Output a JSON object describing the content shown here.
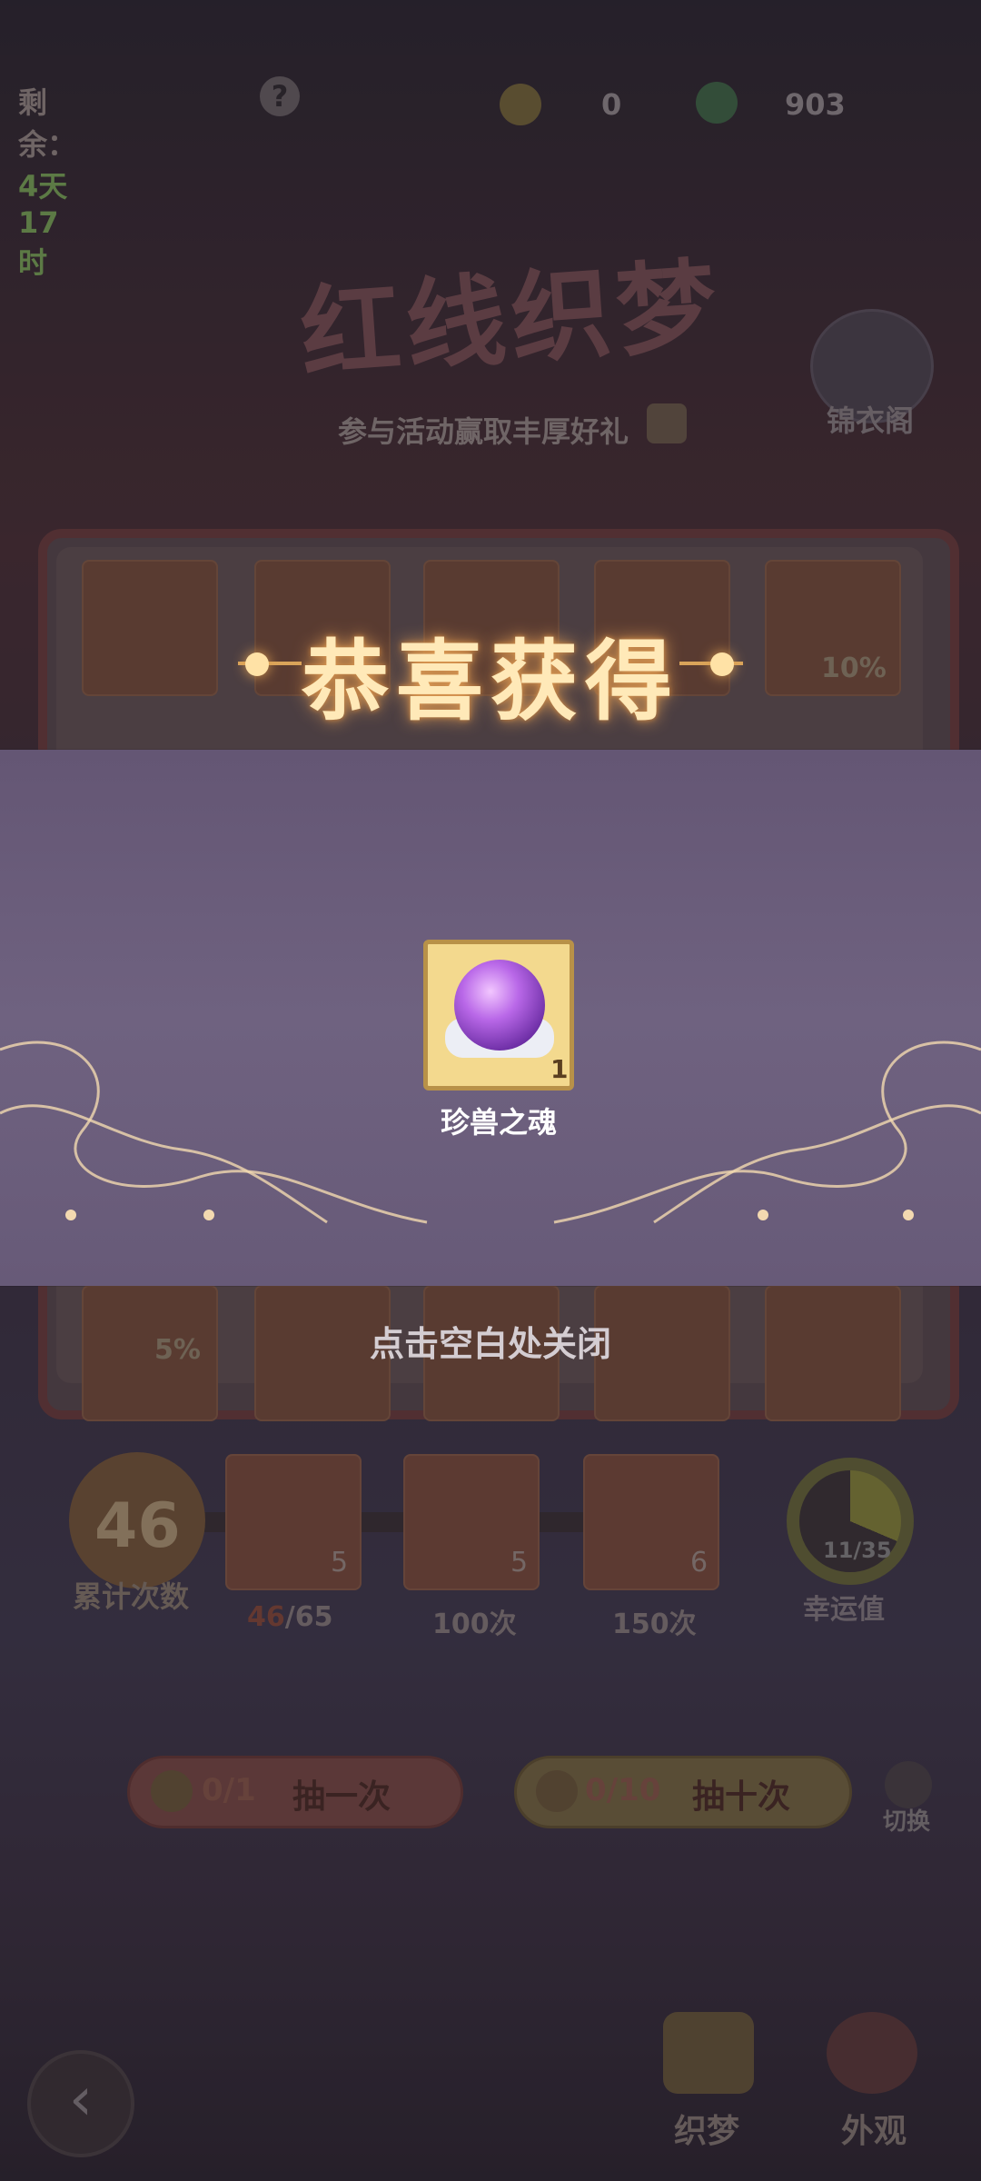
{
  "topbar": {
    "remaining_label": "剩余：",
    "remaining_value": "4天17时",
    "help_icon": "?",
    "currency1_value": "0",
    "currency2_value": "903"
  },
  "event": {
    "title": "红线织梦",
    "subtitle": "参与活动赢取丰厚好礼",
    "wardrobe_label": "锦衣阁"
  },
  "board": {
    "cell_percent_1": "10%",
    "cell_percent_2": "5%"
  },
  "progress": {
    "count_value": "46",
    "count_label": "累计次数",
    "rewards": [
      {
        "qty": "5",
        "label_current": "46",
        "label_rest": "/65"
      },
      {
        "qty": "5",
        "label": "100次"
      },
      {
        "qty": "6",
        "label": "150次"
      }
    ],
    "lucky_value": "11/35",
    "lucky_fraction": 0.314,
    "lucky_label": "幸运值"
  },
  "draw": {
    "single_count": "0/1",
    "single_label": "抽一次",
    "ten_count": "0/10",
    "ten_label": "抽十次",
    "switch_label": "切换"
  },
  "nav": {
    "back_icon": "‹",
    "weave_label": "织梦",
    "appearance_label": "外观"
  },
  "modal": {
    "title": "恭喜获得",
    "item_name": "珍兽之魂",
    "item_qty": "1",
    "close_hint": "点击空白处关闭"
  },
  "colors": {
    "accent_gold": "#ffe9b8",
    "modal_band": "#6f6280",
    "item_card": "#f3d98e"
  }
}
